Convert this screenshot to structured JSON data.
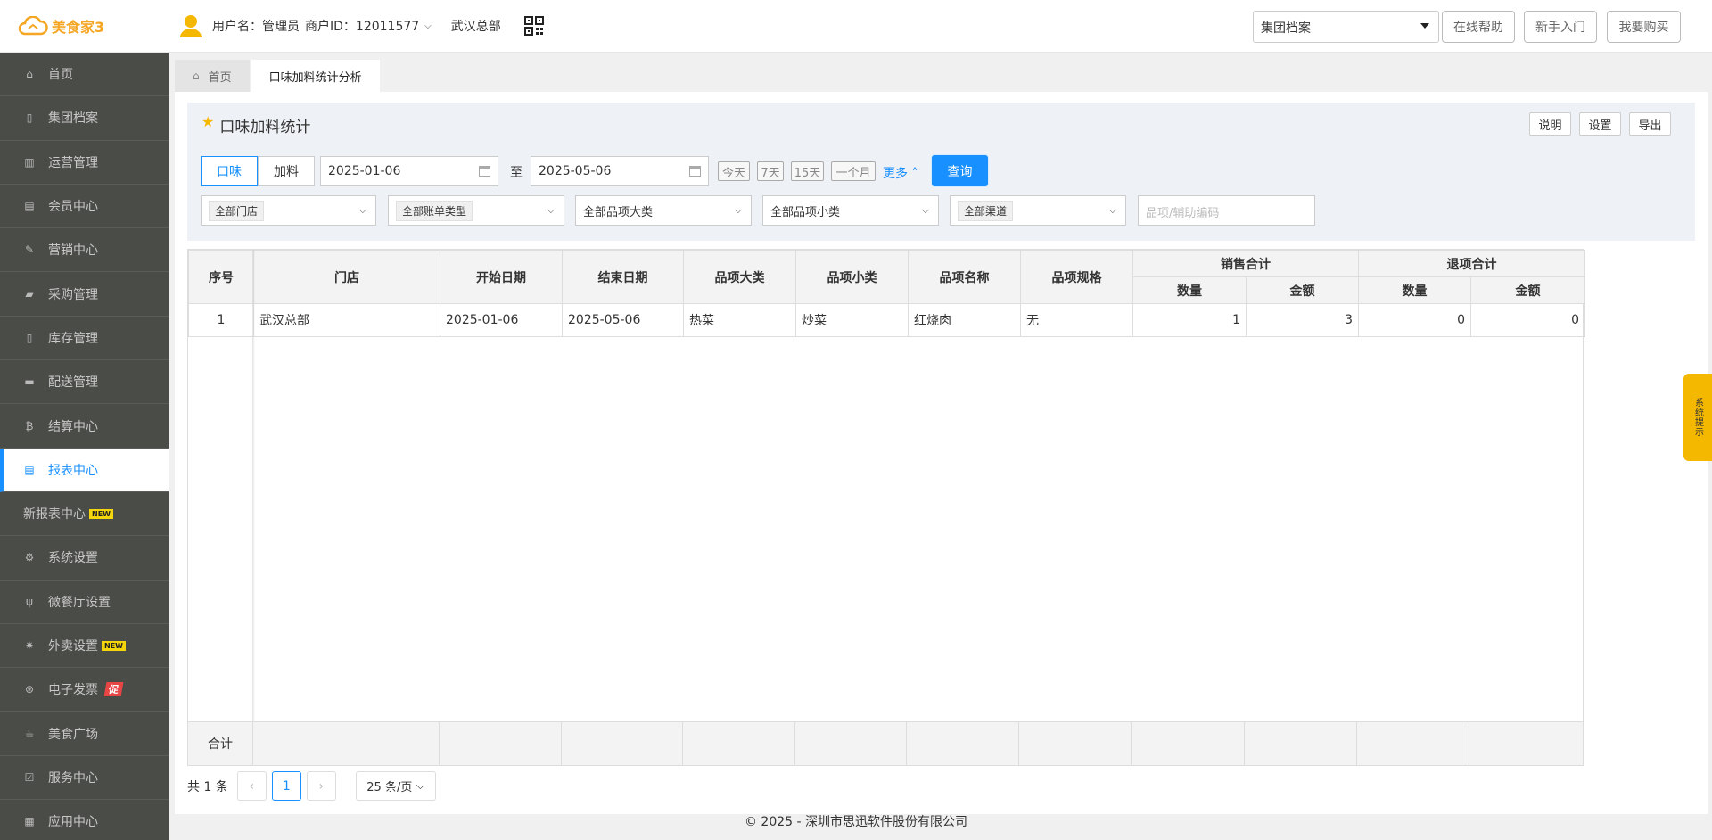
{
  "app": {
    "logo_text": "美食家3"
  },
  "header": {
    "username": "用户名：管理员",
    "merchant_id": "商户ID：12011577",
    "store": "武汉总部",
    "select_value": "集团档案",
    "buttons": [
      "在线帮助",
      "新手入门",
      "我要购买"
    ]
  },
  "sidebar": {
    "items": [
      {
        "label": "首页",
        "icon": "home-icon"
      },
      {
        "label": "集团档案",
        "icon": "file-icon"
      },
      {
        "label": "运营管理",
        "icon": "bar-chart-icon"
      },
      {
        "label": "会员中心",
        "icon": "id-card-icon"
      },
      {
        "label": "营销中心",
        "icon": "edit-icon"
      },
      {
        "label": "采购管理",
        "icon": "book-icon"
      },
      {
        "label": "库存管理",
        "icon": "tablet-icon"
      },
      {
        "label": "配送管理",
        "icon": "truck-icon"
      },
      {
        "label": "结算中心",
        "icon": "bitcoin-icon"
      },
      {
        "label": "报表中心",
        "icon": "report-icon"
      },
      {
        "label": "新报表中心",
        "badge": "NEW"
      },
      {
        "label": "系统设置",
        "icon": "gears-icon"
      },
      {
        "label": "微餐厅设置",
        "icon": "cutlery-icon"
      },
      {
        "label": "外卖设置",
        "icon": "gear-icon",
        "badge": "NEW"
      },
      {
        "label": "电子发票",
        "icon": "invoice-icon",
        "badge": "促"
      },
      {
        "label": "美食广场",
        "icon": "coffee-icon"
      },
      {
        "label": "服务中心",
        "icon": "check-square-icon"
      },
      {
        "label": "应用中心",
        "icon": "apps-icon"
      }
    ]
  },
  "tabs": [
    "首页",
    "口味加料统计分析"
  ],
  "page": {
    "title": "口味加料统计",
    "actions": [
      "说明",
      "设置",
      "导出"
    ],
    "segments": [
      "口味",
      "加料"
    ],
    "date_from": "2025-01-06",
    "date_to": "2025-05-06",
    "to_label": "至",
    "quick_ranges": [
      "今天",
      "7天",
      "15天",
      "一个月"
    ],
    "more_label": "更多",
    "query_label": "查询",
    "selects": [
      "全部门店",
      "全部账单类型",
      "全部品项大类",
      "全部品项小类",
      "全部渠道"
    ],
    "code_placeholder": "品项/辅助编码"
  },
  "table": {
    "headers": [
      "序号",
      "门店",
      "开始日期",
      "结束日期",
      "品项大类",
      "品项小类",
      "品项名称",
      "品项规格"
    ],
    "group_headers": [
      "销售合计",
      "退项合计"
    ],
    "sub_headers": [
      "数量",
      "金额",
      "数量",
      "金额"
    ],
    "rows": [
      [
        "1",
        "武汉总部",
        "2025-01-06",
        "2025-05-06",
        "热菜",
        "炒菜",
        "红烧肉",
        "无",
        "1",
        "3",
        "0",
        "0"
      ]
    ],
    "total_label": "合计"
  },
  "pager": {
    "total": "共 1 条",
    "current": "1",
    "page_size": "25 条/页"
  },
  "footer": "© 2025 - 深圳市思迅软件股份有限公司",
  "side_hint": "系统提示",
  "colors": {
    "primary": "#1890ff",
    "sidebar": "#4a4c48",
    "accent": "#f5b800"
  }
}
